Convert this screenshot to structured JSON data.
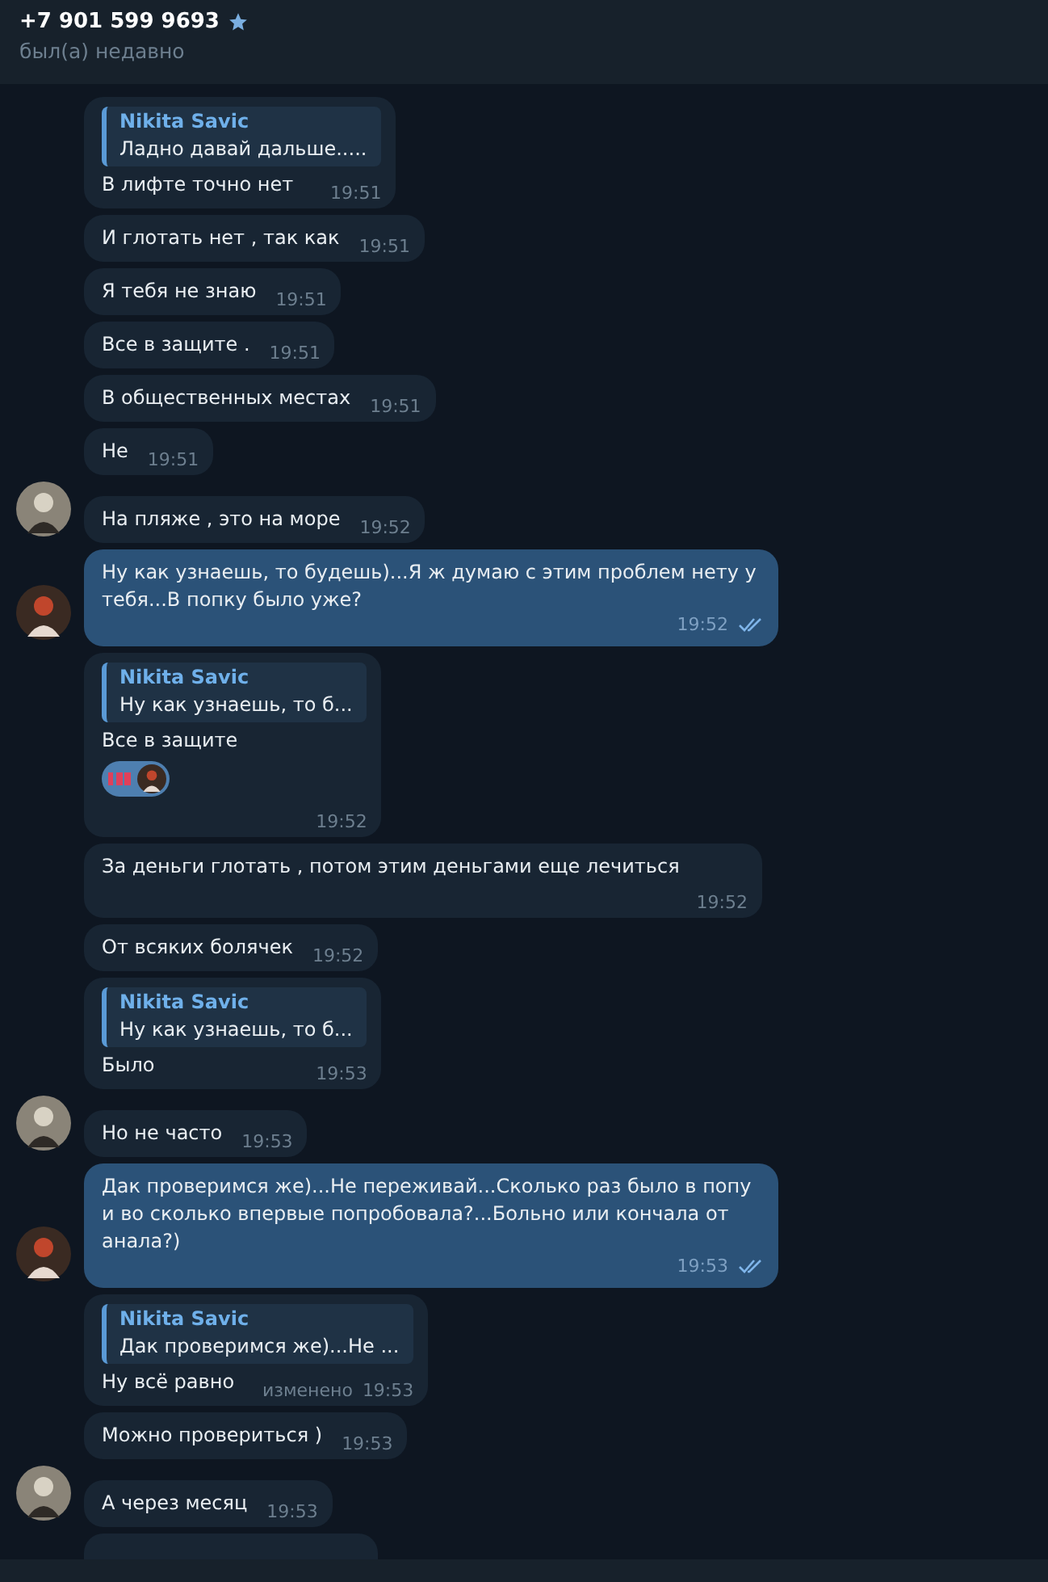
{
  "header": {
    "title": "+7 901 599 9693",
    "starred": true,
    "status": "был(а) недавно"
  },
  "messages": [
    {
      "kind": "incoming",
      "avatar": false,
      "reply": {
        "author": "Nikita Savic",
        "text": "Ладно давай дальше....."
      },
      "text": "В лифте точно нет",
      "time": "19:51"
    },
    {
      "kind": "incoming",
      "avatar": false,
      "text": "И глотать нет , так как",
      "time": "19:51"
    },
    {
      "kind": "incoming",
      "avatar": false,
      "text": "Я тебя не знаю",
      "time": "19:51"
    },
    {
      "kind": "incoming",
      "avatar": false,
      "text": "Все в защите .",
      "time": "19:51"
    },
    {
      "kind": "incoming",
      "avatar": false,
      "text": "В общественных местах",
      "time": "19:51"
    },
    {
      "kind": "incoming",
      "avatar": false,
      "text": "Не",
      "time": "19:51"
    },
    {
      "kind": "incoming",
      "avatar": true,
      "text": "На пляже , это на море",
      "time": "19:52"
    },
    {
      "kind": "outgoing",
      "avatar": true,
      "text": "Ну как узнаешь, то будешь)...Я ж думаю с этим проблем нету у тебя...В попку было уже?",
      "time": "19:52",
      "read": true
    },
    {
      "kind": "incoming",
      "avatar": false,
      "reply": {
        "author": "Nikita Savic",
        "text": "Ну как узнаешь, то б..."
      },
      "text": "Все в защите",
      "reaction": true,
      "time": "19:52"
    },
    {
      "kind": "incoming",
      "avatar": false,
      "text": "За деньги глотать , потом этим деньгами еще лечиться",
      "time": "19:52"
    },
    {
      "kind": "incoming",
      "avatar": false,
      "text": "От всяких болячек",
      "time": "19:52"
    },
    {
      "kind": "incoming",
      "avatar": false,
      "reply": {
        "author": "Nikita Savic",
        "text": "Ну как узнаешь, то б..."
      },
      "text": "Было",
      "time": "19:53"
    },
    {
      "kind": "incoming",
      "avatar": true,
      "text": "Но не часто",
      "time": "19:53"
    },
    {
      "kind": "outgoing",
      "avatar": true,
      "text": "Дак проверимся же)...Не переживай...Сколько раз было в попу и во сколько впервые попробовала?...Больно или кончала от анала?)",
      "time": "19:53",
      "read": true
    },
    {
      "kind": "incoming",
      "avatar": false,
      "reply": {
        "author": "Nikita Savic",
        "text": "Дак проверимся же)...Не ..."
      },
      "text": "Ну всё равно",
      "edited": "изменено",
      "time": "19:53"
    },
    {
      "kind": "incoming",
      "avatar": false,
      "text": "Можно провериться )",
      "time": "19:53"
    },
    {
      "kind": "incoming",
      "avatar": true,
      "text": "А через месяц",
      "time": "19:53"
    },
    {
      "kind": "cut"
    }
  ]
}
